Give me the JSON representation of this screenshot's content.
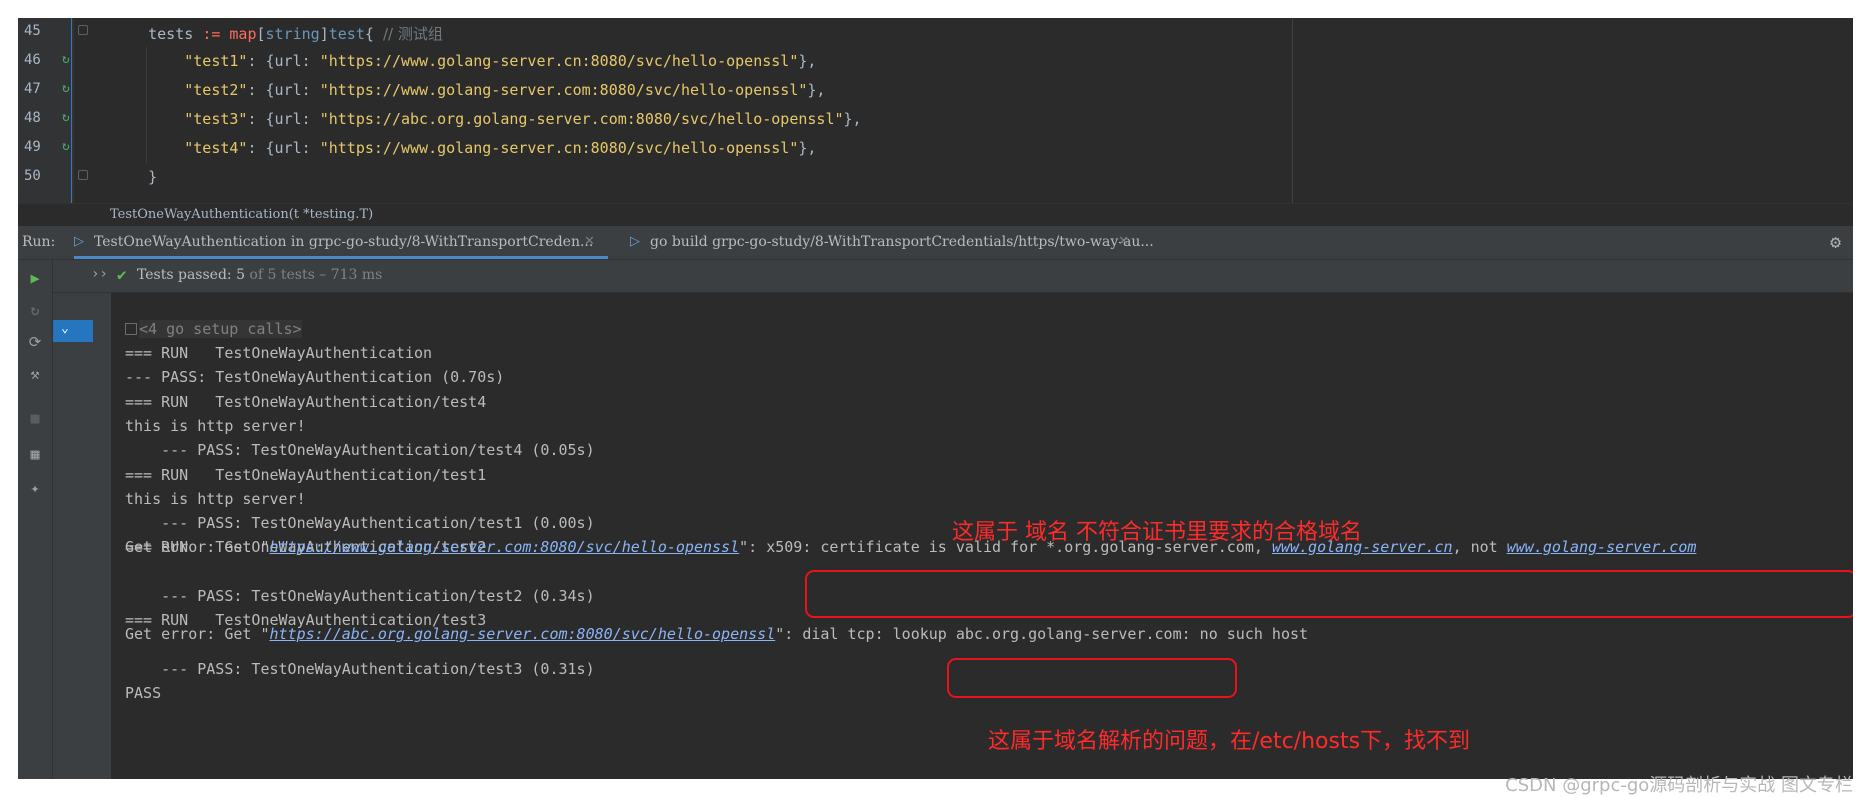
{
  "editor": {
    "lines": [
      {
        "num": "45",
        "parts": [
          {
            "t": "    tests ",
            "c": ""
          },
          {
            "t": ":=",
            "c": "kw"
          },
          {
            "t": " ",
            "c": ""
          },
          {
            "t": "map",
            "c": "kw"
          },
          {
            "t": "[",
            "c": ""
          },
          {
            "t": "string",
            "c": "ty"
          },
          {
            "t": "]",
            "c": ""
          },
          {
            "t": "test",
            "c": "ty"
          },
          {
            "t": "{ ",
            "c": ""
          },
          {
            "t": "// 测试组",
            "c": "cm"
          }
        ]
      },
      {
        "num": "46",
        "parts": [
          {
            "t": "        ",
            "c": ""
          },
          {
            "t": "\"test1\"",
            "c": "str"
          },
          {
            "t": ": {url: ",
            "c": ""
          },
          {
            "t": "\"https://www.golang-server.cn:8080/svc/hello-openssl\"",
            "c": "str"
          },
          {
            "t": "},",
            "c": ""
          }
        ]
      },
      {
        "num": "47",
        "parts": [
          {
            "t": "        ",
            "c": ""
          },
          {
            "t": "\"test2\"",
            "c": "str"
          },
          {
            "t": ": {url: ",
            "c": ""
          },
          {
            "t": "\"https://www.golang-server.com:8080/svc/hello-openssl\"",
            "c": "str"
          },
          {
            "t": "},",
            "c": ""
          }
        ]
      },
      {
        "num": "48",
        "parts": [
          {
            "t": "        ",
            "c": ""
          },
          {
            "t": "\"test3\"",
            "c": "str"
          },
          {
            "t": ": {url: ",
            "c": ""
          },
          {
            "t": "\"https://abc.org.golang-server.com:8080/svc/hello-openssl\"",
            "c": "str"
          },
          {
            "t": "},",
            "c": ""
          }
        ]
      },
      {
        "num": "49",
        "parts": [
          {
            "t": "        ",
            "c": ""
          },
          {
            "t": "\"test4\"",
            "c": "str"
          },
          {
            "t": ": {url: ",
            "c": ""
          },
          {
            "t": "\"https://www.golang-server.cn:8080/svc/hello-openssl\"",
            "c": "str"
          },
          {
            "t": "},",
            "c": ""
          }
        ]
      },
      {
        "num": "50",
        "parts": [
          {
            "t": "    }",
            "c": ""
          }
        ]
      }
    ],
    "breadcrumb": "TestOneWayAuthentication(t *testing.T)"
  },
  "run": {
    "label": "Run:",
    "tab_active": "TestOneWayAuthentication in grpc-go-study/8-WithTransportCreden...",
    "tab_other": "go build grpc-go-study/8-WithTransportCredentials/https/two-way-au...",
    "tests_passed": "Tests passed: 5",
    "tests_detail": " of 5 tests – 713 ms"
  },
  "console": {
    "setup": "<4 go setup calls>",
    "lines": [
      "=== RUN   TestOneWayAuthentication",
      "--- PASS: TestOneWayAuthentication (0.70s)",
      "=== RUN   TestOneWayAuthentication/test4",
      "this is http server!",
      "    --- PASS: TestOneWayAuthentication/test4 (0.05s)",
      "=== RUN   TestOneWayAuthentication/test1",
      "this is http server!",
      "    --- PASS: TestOneWayAuthentication/test1 (0.00s)",
      "=== RUN   TestOneWayAuthentication/test2",
      "",
      "    --- PASS: TestOneWayAuthentication/test2 (0.34s)",
      "=== RUN   TestOneWayAuthentication/test3",
      "",
      "    --- PASS: TestOneWayAuthentication/test3 (0.31s)",
      "PASS"
    ],
    "err2": {
      "prefix": "Get error: Get \"",
      "link": "https://www.golang-server.com:8080/svc/hello-openssl",
      "mid": "\": x509: certificate is valid for *.org.golang-server.com, ",
      "link2": "www.golang-server.cn",
      "mid2": ", not ",
      "link3": "www.golang-server.com"
    },
    "err3": {
      "prefix": "Get error: Get \"",
      "link": "https://abc.org.golang-server.com:8080/svc/hello-openssl",
      "suffix": "\": dial tcp: lookup abc.org.golang-server.com: no such host"
    }
  },
  "annotations": {
    "note1": "这属于 域名 不符合证书里要求的合格域名",
    "note2": "这属于域名解析的问题，在/etc/hosts下，找不到"
  },
  "watermark": "CSDN @grpc-go源码剖析与实战 图文专栏",
  "colors": {
    "annotation": "#ff2a2a",
    "pass_check": "#5fb85a",
    "tab_underline": "#4a88c7"
  }
}
